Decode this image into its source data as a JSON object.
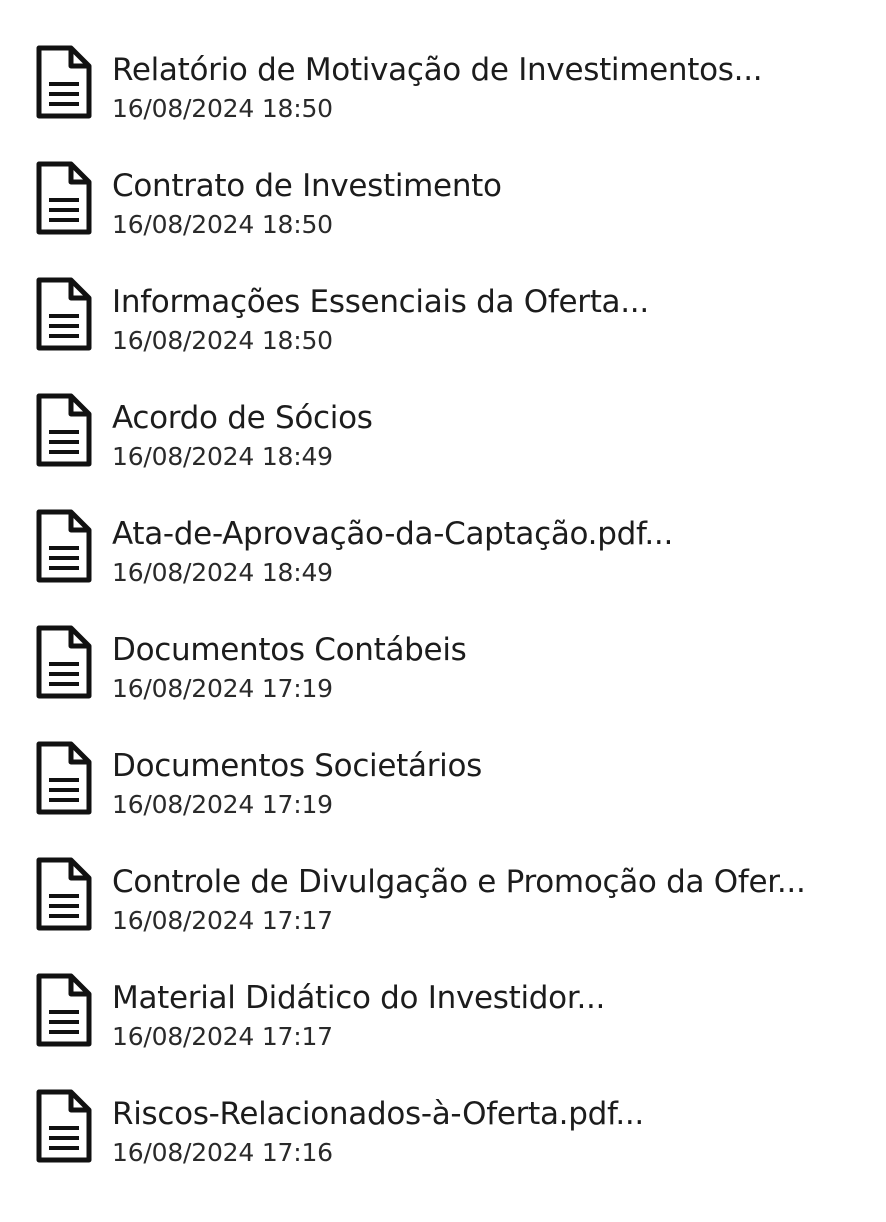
{
  "documents": [
    {
      "title": "Relatório de Motivação de Investimentos...",
      "date": "16/08/2024 18:50",
      "icon": "document-icon"
    },
    {
      "title": "Contrato de Investimento",
      "date": "16/08/2024 18:50",
      "icon": "document-icon"
    },
    {
      "title": "Informações Essenciais da Oferta...",
      "date": "16/08/2024 18:50",
      "icon": "document-icon"
    },
    {
      "title": "Acordo de Sócios",
      "date": "16/08/2024 18:49",
      "icon": "document-icon"
    },
    {
      "title": "Ata-de-Aprovação-da-Captação.pdf...",
      "date": "16/08/2024 18:49",
      "icon": "document-icon"
    },
    {
      "title": "Documentos Contábeis",
      "date": "16/08/2024 17:19",
      "icon": "document-icon"
    },
    {
      "title": "Documentos Societários",
      "date": "16/08/2024 17:19",
      "icon": "document-icon"
    },
    {
      "title": "Controle de Divulgação e Promoção da Ofer...",
      "date": "16/08/2024 17:17",
      "icon": "document-icon"
    },
    {
      "title": "Material Didático do Investidor...",
      "date": "16/08/2024 17:17",
      "icon": "document-icon"
    },
    {
      "title": "Riscos-Relacionados-à-Oferta.pdf...",
      "date": "16/08/2024 17:16",
      "icon": "document-icon"
    }
  ]
}
